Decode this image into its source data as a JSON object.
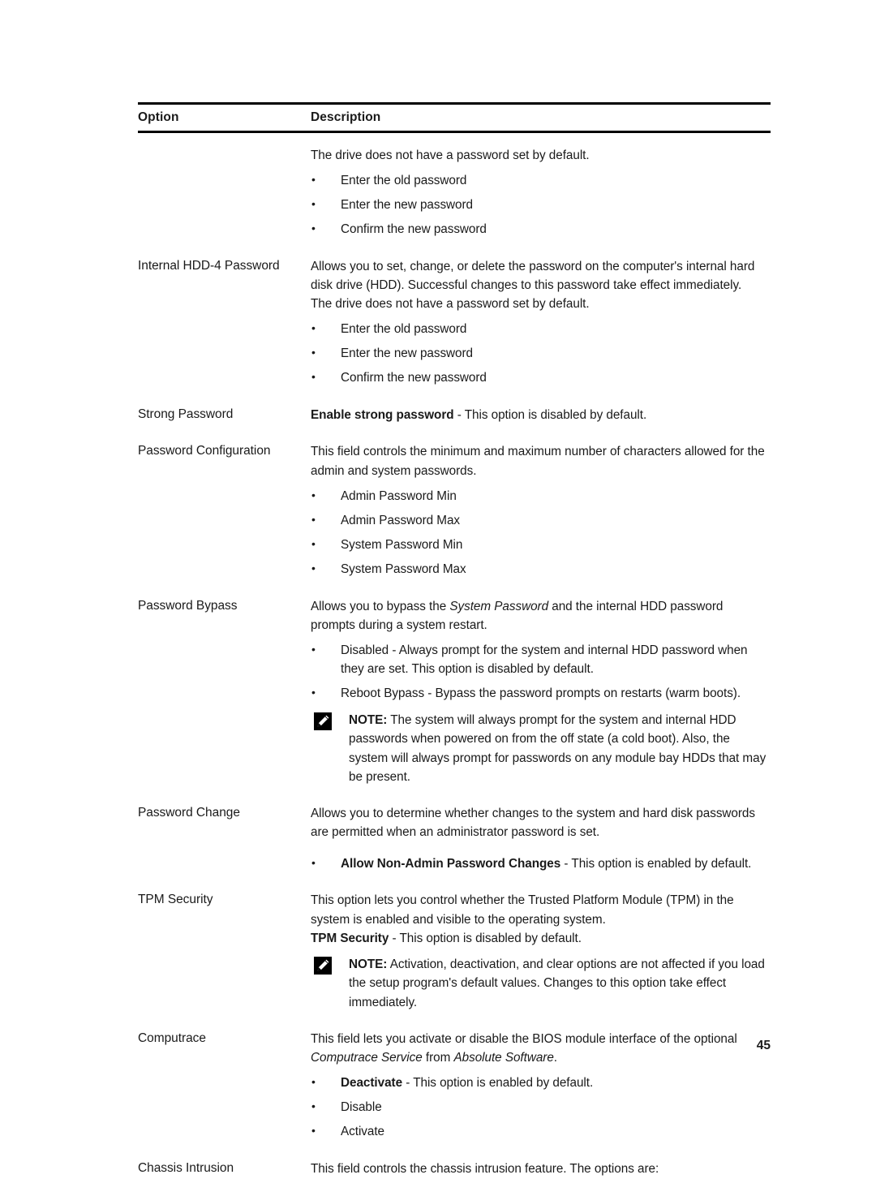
{
  "document": {
    "page_number": "45",
    "note_icon_name": "dell-note-pencil-icon"
  },
  "table": {
    "headers": {
      "option": "Option",
      "description": "Description"
    },
    "rows": [
      {
        "option": "",
        "intro": "The drive does not have a password set by default.",
        "bullets": [
          "Enter the old password",
          "Enter the new password",
          "Confirm the new password"
        ]
      },
      {
        "option": "Internal HDD-4 Password",
        "para1": "Allows you to set, change, or delete the password on the computer's internal hard disk drive (HDD). Successful changes to this password take effect immediately.",
        "para2": "The drive does not have a password set by default.",
        "bullets": [
          "Enter the old password",
          "Enter the new password",
          "Confirm the new password"
        ]
      },
      {
        "option": "Strong Password",
        "bold_lead": "Enable strong password",
        "rest": " - This option is disabled by default."
      },
      {
        "option": "Password Configuration",
        "para1": "This field controls the minimum and maximum number of characters allowed for the admin and system passwords.",
        "bullets": [
          "Admin Password Min",
          "Admin Password Max",
          "System Password Min",
          "System Password Max"
        ]
      },
      {
        "option": "Password Bypass",
        "para_pre": "Allows you to bypass the ",
        "para_italic": "System Password",
        "para_post": " and the internal HDD password prompts during a system restart.",
        "bullets": [
          "Disabled - Always prompt for the system and internal HDD password when they are set. This option is disabled by default.",
          "Reboot Bypass - Bypass the password prompts on restarts (warm boots)."
        ],
        "note_label": "NOTE:",
        "note_text": " The system will always prompt for the system and internal HDD passwords when powered on from the off state (a cold boot). Also, the system will always prompt for passwords on any module bay HDDs that may be present."
      },
      {
        "option": "Password Change",
        "para1": "Allows you to determine whether changes to the system and hard disk passwords are permitted when an administrator password is set.",
        "bullet_bold": "Allow Non-Admin Password Changes",
        "bullet_rest": " - This option is enabled by default."
      },
      {
        "option": "TPM Security",
        "para1": "This option lets you control whether the Trusted Platform Module (TPM) in the system is enabled and visible to the operating system.",
        "para2_bold": "TPM Security",
        "para2_rest": " - This option is disabled by default.",
        "note_label": "NOTE:",
        "note_text": " Activation, deactivation, and clear options are not affected if you load the setup program's default values. Changes to this option take effect immediately."
      },
      {
        "option": "Computrace",
        "para_pre": "This field lets you activate or disable the BIOS module interface of the optional ",
        "para_italic1": "Computrace Service",
        "para_mid": " from ",
        "para_italic2": "Absolute Software",
        "para_post": ".",
        "bullet_bold": "Deactivate",
        "bullet_rest": " - This option is enabled by default.",
        "bullets_plain": [
          "Disable",
          "Activate"
        ]
      },
      {
        "option": "Chassis Intrusion",
        "para1": "This field controls the chassis intrusion feature. The options are:"
      }
    ]
  }
}
